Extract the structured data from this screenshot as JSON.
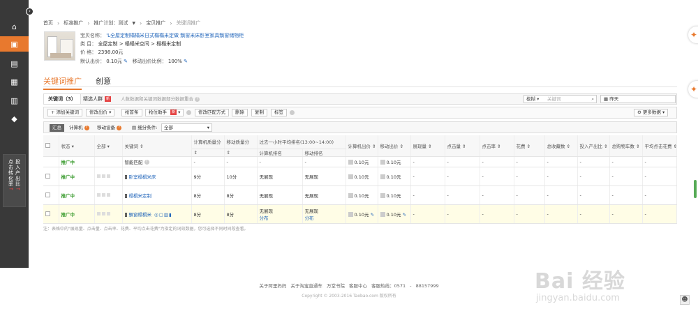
{
  "sidebar": {
    "collapse_glyph": "›",
    "promo_lines": [
      "点击转化率",
      "投入产出比"
    ],
    "promo_arrows": "↑"
  },
  "breadcrumb": {
    "items": [
      "首页",
      "标准推广",
      "推广计划：测试",
      "宝贝推广",
      "关键词推广"
    ]
  },
  "product": {
    "name_label": "宝贝名称：",
    "name_value": "'L全屋定制榻榻米日式榻榻米定做 飘窗米床卧室家具飘窗储物柜",
    "category_label": "类    目：",
    "category_value": "全屋定制 > 榻榻米空间 > 榻榻米定制",
    "price_label": "价    格：",
    "price_value": "2398.00元",
    "bid_label": "默认出价：",
    "bid_value": "0.10元",
    "mobile_label": "移动出价比例：",
    "mobile_value": "100%"
  },
  "main_tabs": [
    "关键词推广",
    "创意"
  ],
  "subtabs": {
    "keywords": "关键词（3）",
    "crowd": "精选人群",
    "crowd_badge": "新",
    "note": "人数数据和关键词数据部分数据重合",
    "search_mode": "模糊",
    "search_placeholder": "关键词",
    "date": "昨天"
  },
  "toolbar": {
    "add": "+ 添加关键词",
    "modify_bid": "修改出价",
    "grab_top": "抢首条",
    "grab_helper": "抢位助手",
    "helper_badge": "新",
    "change_match": "修改匹配方式",
    "delete": "删除",
    "copy": "复制",
    "tag": "标签",
    "more_data": "更多数据"
  },
  "filter": {
    "summary": "汇总",
    "pc": "计算机",
    "mobile": "移动设备",
    "cond_label": "细分条件:",
    "cond_value": "全部"
  },
  "table": {
    "headers": [
      "状态",
      "全部",
      "关键词",
      "计算机质量分",
      "移动质量分",
      "过去一小时平均排名(13:00~14:00)",
      "计算机出价",
      "移动出价",
      "展现量",
      "点击量",
      "点击率",
      "花费",
      "总收藏数",
      "投入产出比",
      "总购物车数",
      "平均点击花费"
    ],
    "rank_sub": [
      "计算机排名",
      "移动排名"
    ],
    "rows": [
      {
        "status": "推广中",
        "keyword": "智能匹配",
        "pc_q": "-",
        "mob_q": "-",
        "pc_rank": "-",
        "mob_rank": "-",
        "pc_bid": "0.10元",
        "mob_bid": "0.10元",
        "dash": "-"
      },
      {
        "status": "推广中",
        "keyword": "卧室榻榻米床",
        "pc_q": "9分",
        "mob_q": "10分",
        "pc_rank": "无展现",
        "mob_rank": "无展现",
        "pc_bid": "0.10元",
        "mob_bid": "0.10元",
        "dash": "-"
      },
      {
        "status": "推广中",
        "keyword": "榻榻米定制",
        "pc_q": "8分",
        "mob_q": "8分",
        "pc_rank": "无展现",
        "mob_rank": "无展现",
        "pc_bid": "0.10元",
        "mob_bid": "0.10元",
        "dash": "-"
      },
      {
        "status": "推广中",
        "keyword": "飘窗榻榻米",
        "pc_q": "8分",
        "mob_q": "8分",
        "pc_rank": "无展现",
        "mob_rank": "无展现",
        "pc_bid": "0.10元",
        "mob_bid": "0.10元",
        "dash": "-",
        "dist": "分布"
      }
    ]
  },
  "footnote": "注：表格中的\"展现量、点击量、点击率、花费、平均点击花费\"为指定的词效数据，您可选择不同时间段查看。",
  "footer": {
    "links": "关于阿里妈妈 关于淘宝直通车 万堂书院 客服中心 客服热线：0571 - 88157999",
    "copyright": "Copyright © 2003-2016 Taobao.com 版权所有"
  },
  "watermark": {
    "brand": "Bai 经验",
    "site": "jingyan.baidu.com"
  },
  "colors": {
    "accent": "#e8792e",
    "sidebar": "#393939",
    "status": "#3a9b2e",
    "link": "#2266bb"
  }
}
